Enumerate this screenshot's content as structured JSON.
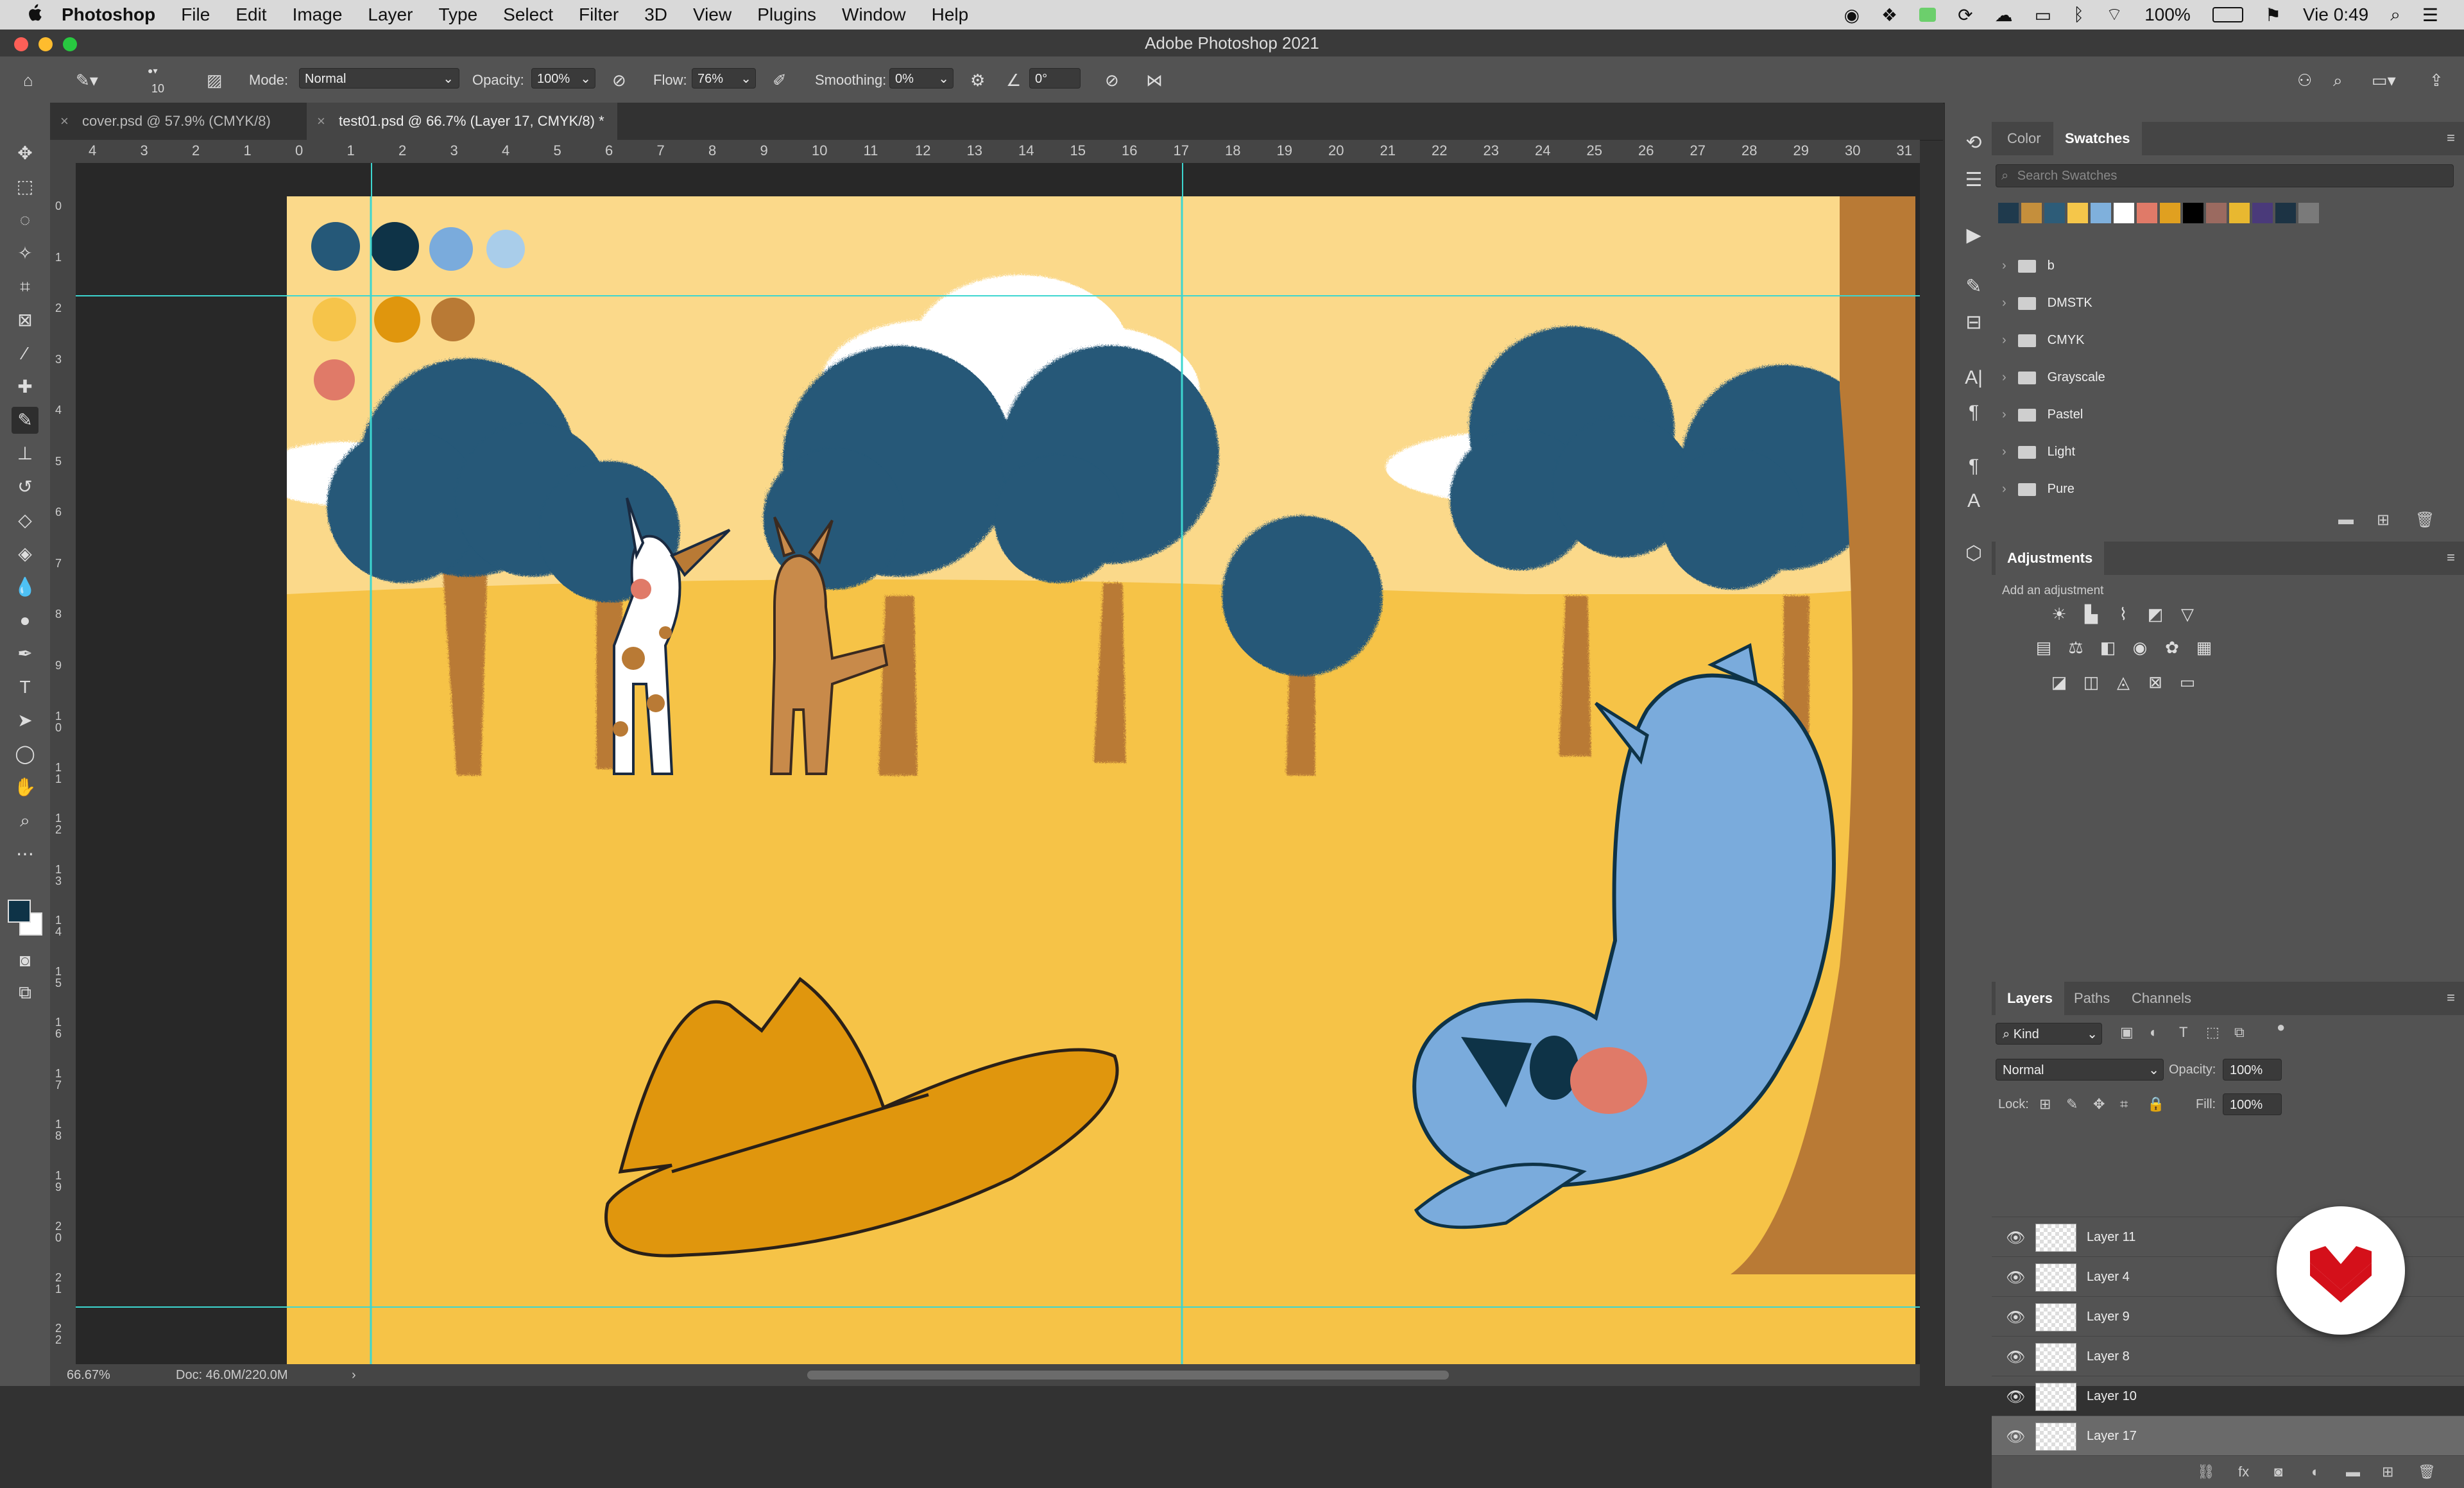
{
  "menubar": {
    "apple_icon": "apple-icon",
    "app_name": "Photoshop",
    "items": [
      "File",
      "Edit",
      "Image",
      "Layer",
      "Type",
      "Select",
      "Filter",
      "3D",
      "View",
      "Plugins",
      "Window",
      "Help"
    ],
    "battery": "100%",
    "clock": "Vie 0:49"
  },
  "window": {
    "title": "Adobe Photoshop 2021"
  },
  "options_bar": {
    "brush_size": "10",
    "mode_label": "Mode:",
    "mode_value": "Normal",
    "opacity_label": "Opacity:",
    "opacity_value": "100%",
    "flow_label": "Flow:",
    "flow_value": "76%",
    "smoothing_label": "Smoothing:",
    "smoothing_value": "0%",
    "angle_value": "0°"
  },
  "tabs": [
    {
      "label": "cover.psd @ 57.9% (CMYK/8)",
      "active": false
    },
    {
      "label": "test01.psd @ 66.7% (Layer 17, CMYK/8) *",
      "active": true
    }
  ],
  "ruler_top": [
    "4",
    "3",
    "2",
    "1",
    "0",
    "1",
    "2",
    "3",
    "4",
    "5",
    "6",
    "7",
    "8",
    "9",
    "10",
    "11",
    "12",
    "13",
    "14",
    "15",
    "16",
    "17",
    "18",
    "19",
    "20",
    "21",
    "22",
    "23",
    "24",
    "25",
    "26",
    "27",
    "28",
    "29",
    "30",
    "31",
    "3"
  ],
  "ruler_left": [
    "0",
    "1",
    "2",
    "3",
    "4",
    "5",
    "6",
    "7",
    "8",
    "9",
    "1 0",
    "1 1",
    "1 2",
    "1 3",
    "1 4",
    "1 5",
    "1 6",
    "1 7",
    "1 8",
    "1 9",
    "2 0",
    "2 1",
    "2 2"
  ],
  "status": {
    "zoom": "66.67%",
    "doc": "Doc: 46.0M/220.0M"
  },
  "color_panel": {
    "tabs": [
      "Color",
      "Swatches"
    ],
    "search_placeholder": "Search Swatches",
    "recent_swatches": [
      "#1f3a4d",
      "#c58f3c",
      "#2d5c78",
      "#f5c64a",
      "#7fb0dc",
      "#ffffff",
      "#e07a68",
      "#e0a020",
      "#000000",
      "#9b6a60",
      "#e8b830",
      "#4a3a7a",
      "#1c3344",
      "#7a7a7a"
    ],
    "folders": [
      "b",
      "DMSTK",
      "CMYK",
      "Grayscale",
      "Pastel",
      "Light",
      "Pure"
    ]
  },
  "adjustments": {
    "title": "Adjustments",
    "subtitle": "Add an adjustment"
  },
  "layers_panel": {
    "tabs": [
      "Layers",
      "Paths",
      "Channels"
    ],
    "kind_label": "Kind",
    "blend_mode": "Normal",
    "opacity_label": "Opacity:",
    "opacity_value": "100%",
    "lock_label": "Lock:",
    "fill_label": "Fill:",
    "fill_value": "100%",
    "layers": [
      {
        "name": "Layer 11",
        "selected": false
      },
      {
        "name": "Layer 4",
        "selected": false
      },
      {
        "name": "Layer 9",
        "selected": false
      },
      {
        "name": "Layer 8",
        "selected": false
      },
      {
        "name": "Layer 10",
        "selected": false
      },
      {
        "name": "Layer 17",
        "selected": true
      }
    ]
  },
  "artwork": {
    "palette": [
      "#255878",
      "#0e3347",
      "#7aabdc",
      "#a9cdea",
      "#f6c44a",
      "#e0960d",
      "#b97a35",
      "#e07a68"
    ],
    "bg_color": "#f7c444",
    "sky_color": "#fbd98a"
  }
}
